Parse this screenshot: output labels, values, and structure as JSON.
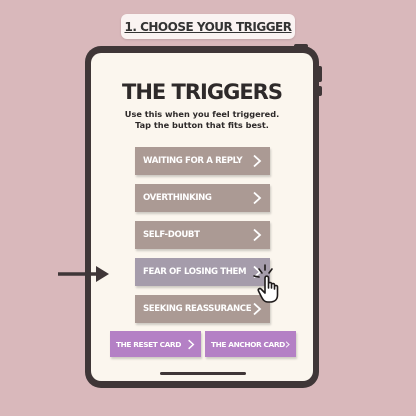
{
  "step_label": "1. CHOOSE YOUR TRIGGER",
  "screen": {
    "title": "THE TRIGGERS",
    "subtitle_line1": "Use this when you feel triggered.",
    "subtitle_line2": "Tap the button that fits best."
  },
  "triggers": [
    {
      "label": "WAITING FOR A REPLY",
      "icon": "chevron-right-icon"
    },
    {
      "label": "OVERTHINKING",
      "icon": "chevron-right-icon"
    },
    {
      "label": "SELF-DOUBT",
      "icon": "chevron-right-icon"
    },
    {
      "label": "FEAR OF LOSING THEM",
      "icon": "chevron-right-icon",
      "selected": true
    },
    {
      "label": "SEEKING REASSURANCE",
      "icon": "chevron-right-icon"
    }
  ],
  "cards": [
    {
      "label": "THE RESET CARD",
      "icon": "chevron-right-icon"
    },
    {
      "label": "THE ANCHOR CARD",
      "icon": "chevron-right-icon"
    }
  ],
  "colors": {
    "background": "#d9b8bb",
    "tablet_frame": "#3f3637",
    "screen": "#fbf6ee",
    "trigger_button": "#ab9a94",
    "trigger_button_selected": "#a59cab",
    "card_button": "#b480c5"
  },
  "icons": {
    "pointer_arrow": "arrow-right-icon",
    "tap_hand": "tapping-hand-icon"
  }
}
